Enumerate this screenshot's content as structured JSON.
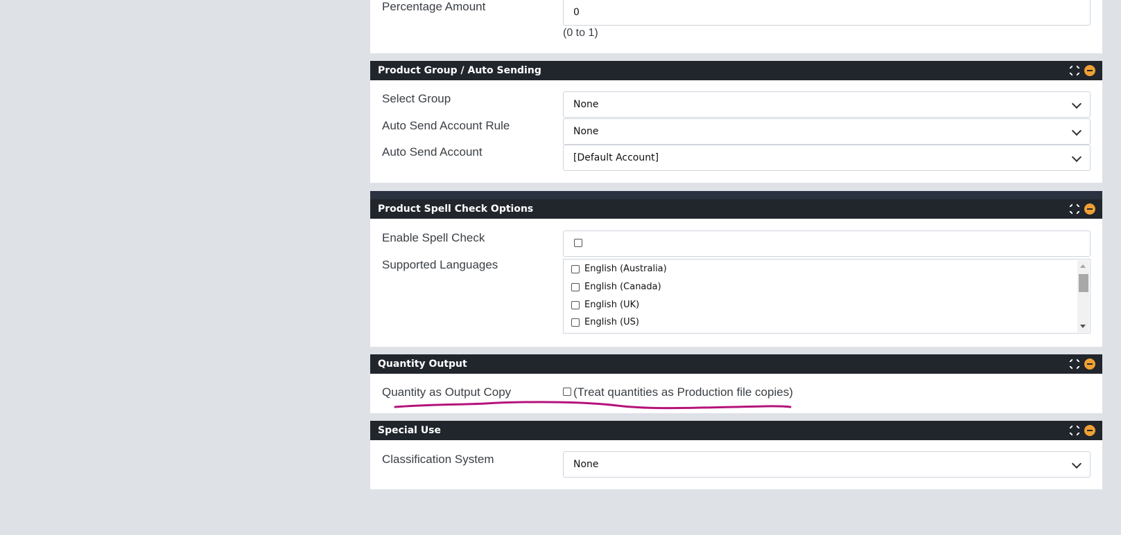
{
  "top_section": {
    "label": "Percentage Amount",
    "value": "0",
    "hint": "(0 to 1)"
  },
  "product_group": {
    "title": "Product Group / Auto Sending",
    "rows": [
      {
        "label": "Select Group",
        "value": "None"
      },
      {
        "label": "Auto Send Account Rule",
        "value": "None"
      },
      {
        "label": "Auto Send Account",
        "value": "[Default Account]"
      }
    ]
  },
  "spell_check": {
    "title": "Product Spell Check Options",
    "enable_label": "Enable Spell Check",
    "languages_label": "Supported Languages",
    "languages": [
      "English (Australia)",
      "English (Canada)",
      "English (UK)",
      "English (US)"
    ]
  },
  "quantity_output": {
    "title": "Quantity Output",
    "label": "Quantity as Output Copy",
    "checkbox_text": "(Treat quantities as Production file copies)"
  },
  "special_use": {
    "title": "Special Use",
    "label": "Classification System",
    "value": "None"
  },
  "colors": {
    "header_bg": "#21252c",
    "collapse_icon": "#f0a033",
    "annotation": "#b5127a",
    "page_bg": "#dee2e6"
  },
  "icons": [
    "expand-icon",
    "collapse-icon",
    "chevron-down-icon",
    "checkbox-icon"
  ]
}
